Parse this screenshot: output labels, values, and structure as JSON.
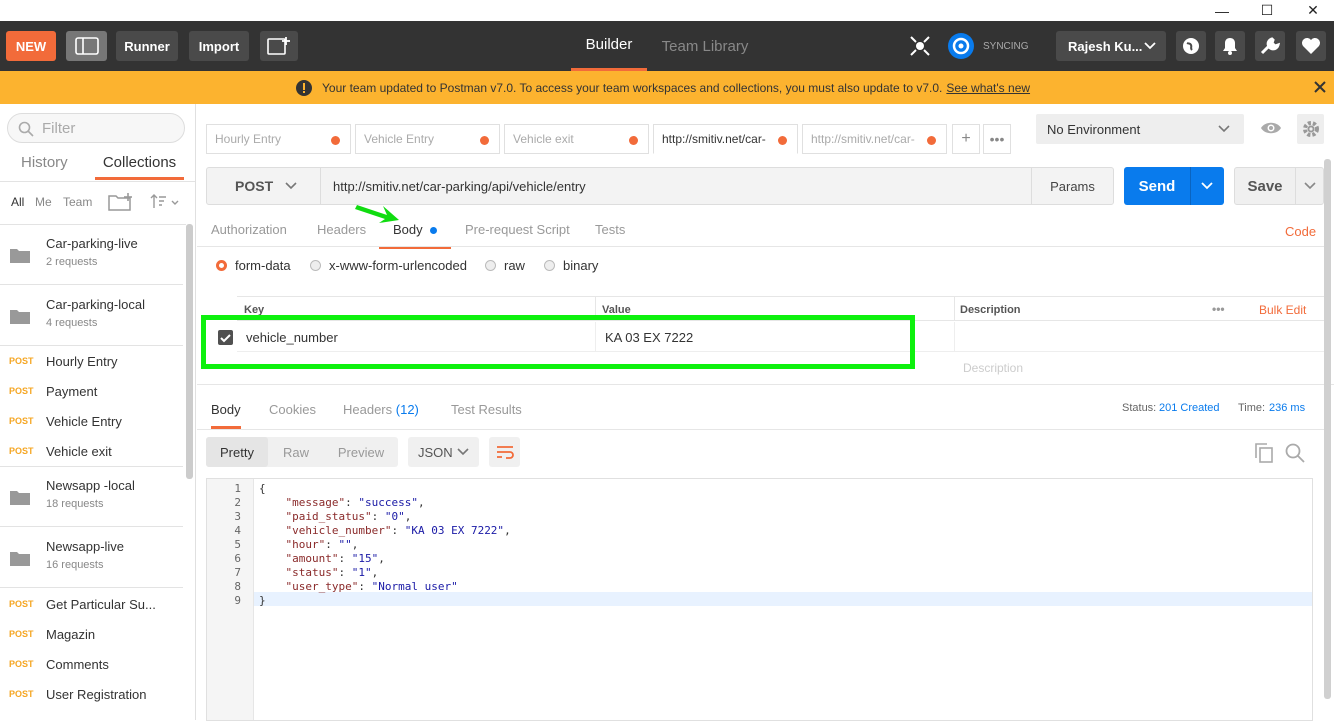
{
  "window": {
    "minimize": "—",
    "maximize": "☐",
    "close": "✕"
  },
  "toolbar": {
    "new_label": "NEW",
    "runner_label": "Runner",
    "import_label": "Import",
    "tabs": [
      "Builder",
      "Team Library"
    ],
    "sync_label": "SYNCING",
    "user_label": "Rajesh Ku...",
    "colors": {
      "bar": "#333333",
      "accent": "#f26b3a"
    }
  },
  "banner": {
    "text": "Your team updated to Postman v7.0. To access your team workspaces and collections, you must also update to v7.0.",
    "link": "See what's new"
  },
  "sidebar": {
    "filter_placeholder": "Filter",
    "tabs": [
      "History",
      "Collections"
    ],
    "subtabs": [
      "All",
      "Me",
      "Team"
    ],
    "collections": [
      {
        "title": "Car-parking-live",
        "count": "2 requests"
      },
      {
        "title": "Car-parking-local",
        "count": "4 requests"
      },
      {
        "title": "Newsapp -local",
        "count": "18 requests"
      },
      {
        "title": "Newsapp-live",
        "count": "16 requests"
      }
    ],
    "requests_a": [
      {
        "method": "POST",
        "name": "Hourly Entry"
      },
      {
        "method": "POST",
        "name": "Payment"
      },
      {
        "method": "POST",
        "name": "Vehicle Entry"
      },
      {
        "method": "POST",
        "name": "Vehicle exit"
      }
    ],
    "requests_b": [
      {
        "method": "POST",
        "name": "Get Particular Su..."
      },
      {
        "method": "POST",
        "name": "Magazin"
      },
      {
        "method": "POST",
        "name": "Comments"
      },
      {
        "method": "POST",
        "name": "User Registration"
      }
    ]
  },
  "request_tabs": [
    "Hourly Entry",
    "Vehicle Entry",
    "Vehicle exit",
    "http://smitiv.net/car-",
    "http://smitiv.net/car-"
  ],
  "environment": "No Environment",
  "request": {
    "method": "POST",
    "url": "http://smitiv.net/car-parking/api/vehicle/entry",
    "params_label": "Params",
    "send_label": "Send",
    "save_label": "Save"
  },
  "sub_tabs": [
    "Authorization",
    "Headers",
    "Body",
    "Pre-request Script",
    "Tests"
  ],
  "code_link": "Code",
  "body_types": [
    "form-data",
    "x-www-form-urlencoded",
    "raw",
    "binary"
  ],
  "kv": {
    "headers": [
      "Key",
      "Value",
      "Description"
    ],
    "bulk_edit": "Bulk Edit",
    "rows": [
      {
        "key": "vehicle_number",
        "value": "KA 03 EX 7222"
      }
    ],
    "placeholder_description": "Description"
  },
  "response": {
    "tabs": [
      "Body",
      "Cookies",
      "Headers",
      "Test Results"
    ],
    "headers_count": "(12)",
    "status_label": "Status:",
    "status_value": "201 Created",
    "time_label": "Time:",
    "time_value": "236 ms",
    "views": [
      "Pretty",
      "Raw",
      "Preview"
    ],
    "format": "JSON",
    "line_numbers": [
      "1",
      "2",
      "3",
      "4",
      "5",
      "6",
      "7",
      "8",
      "9"
    ],
    "json": [
      {
        "k": "\"message\"",
        "v": "\"success\"",
        "comma": ","
      },
      {
        "k": "\"paid_status\"",
        "v": "\"0\"",
        "comma": ","
      },
      {
        "k": "\"vehicle_number\"",
        "v": "\"KA 03 EX 7222\"",
        "comma": ","
      },
      {
        "k": "\"hour\"",
        "v": "\"\"",
        "comma": ","
      },
      {
        "k": "\"amount\"",
        "v": "\"15\"",
        "comma": ","
      },
      {
        "k": "\"status\"",
        "v": "\"1\"",
        "comma": ","
      },
      {
        "k": "\"user_type\"",
        "v": "\"Normal user\"",
        "comma": ""
      }
    ],
    "open_brace": "{",
    "close_brace": "}"
  }
}
